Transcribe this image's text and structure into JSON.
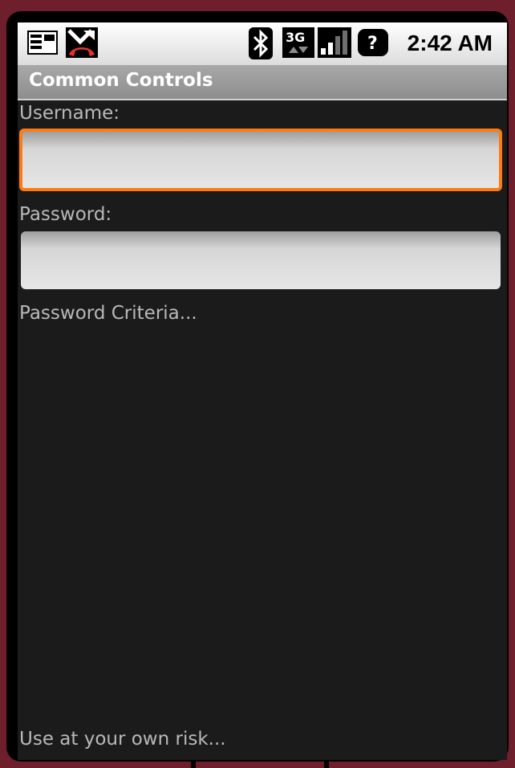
{
  "status_bar": {
    "time": "2:42 AM",
    "icons": [
      "notification-icon",
      "missed-call-icon",
      "bluetooth-icon",
      "3g-icon",
      "signal-bars-icon",
      "unknown-battery-icon"
    ],
    "unknown_badge": "?",
    "network_label": "3G"
  },
  "app": {
    "title": "Common Controls"
  },
  "form": {
    "username_label": "Username:",
    "username_value": "",
    "password_label": "Password:",
    "password_value": "",
    "criteria_text": "Password Criteria...",
    "footer_text": "Use at your own risk..."
  },
  "colors": {
    "focus": "#ff7b12",
    "background": "#1b1b1b",
    "label": "#b9b9b9",
    "device_frame": "#6e1f2b"
  }
}
